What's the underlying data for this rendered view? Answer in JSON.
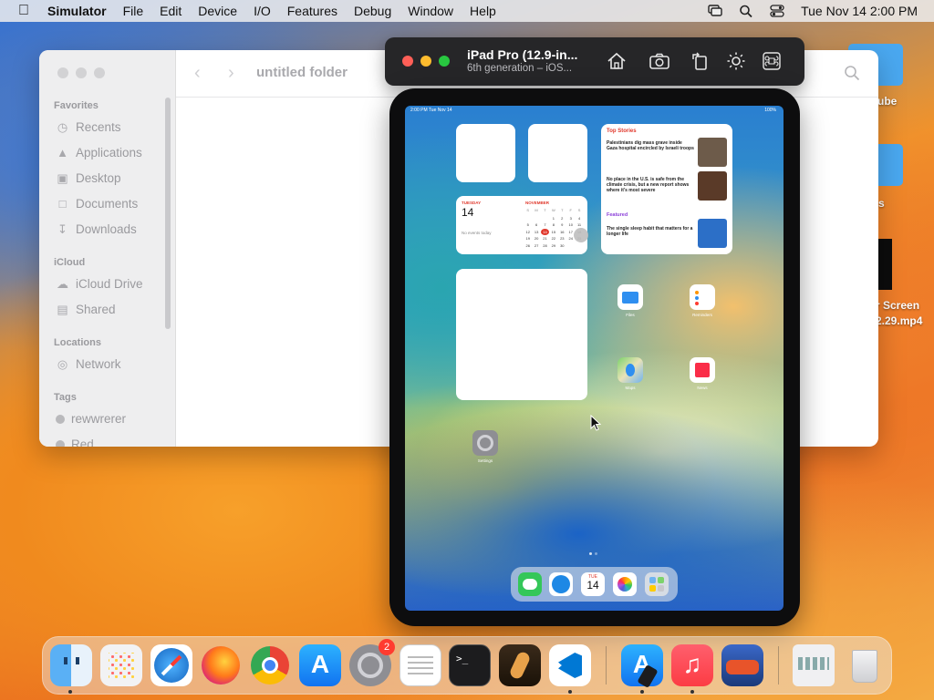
{
  "menubar": {
    "app_name": "Simulator",
    "items": [
      "File",
      "Edit",
      "Device",
      "I/O",
      "Features",
      "Debug",
      "Window",
      "Help"
    ],
    "clock": "Tue Nov 14  2:00 PM"
  },
  "finder": {
    "title": "untitled folder",
    "favorites_heading": "Favorites",
    "favorites": [
      "Recents",
      "Applications",
      "Desktop",
      "Documents",
      "Downloads"
    ],
    "icloud_heading": "iCloud",
    "icloud": [
      "iCloud Drive",
      "Shared"
    ],
    "locations_heading": "Locations",
    "locations": [
      "Network"
    ],
    "tags_heading": "Tags",
    "tags": [
      "rewwrerer",
      "Red"
    ]
  },
  "desktop": {
    "label_1": "ube",
    "label_2": "s",
    "label_3_line1": "r Screen",
    "label_3_line2": "2.29.mp4"
  },
  "simulator": {
    "device_name": "iPad Pro (12.9-in...",
    "device_sub": "6th generation – iOS..."
  },
  "ipad": {
    "status_time": "2:00 PM  Tue Nov 14",
    "status_battery": "100%",
    "calendar": {
      "day_name": "TUESDAY",
      "day_number": "14",
      "no_events": "No events today",
      "month": "NOVEMBER",
      "weekdays": [
        "S",
        "M",
        "T",
        "W",
        "T",
        "F",
        "S"
      ]
    },
    "news": {
      "header": "Top Stories",
      "story1": "Palestinians dig mass grave inside Gaza hospital encircled by Israeli troops",
      "story2": "No place in the U.S. is safe from the climate crisis, but a new report shows where it's most severe",
      "featured_label": "Featured",
      "story3": "The single sleep habit that matters for a longer life"
    },
    "apps": {
      "files": "Files",
      "reminders": "Reminders",
      "maps": "Maps",
      "news": "News",
      "settings": "Settings"
    },
    "dock_calendar_day": "TUE",
    "dock_calendar_num": "14"
  },
  "dock": {
    "settings_badge": "2"
  }
}
